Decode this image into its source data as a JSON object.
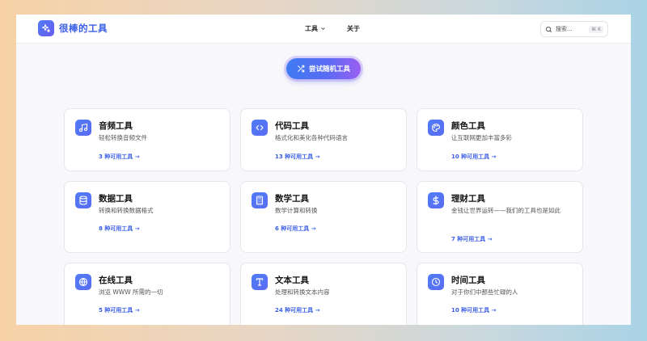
{
  "header": {
    "logo_text": "很棒的工具",
    "nav": [
      {
        "label": "工具",
        "has_dropdown": true
      },
      {
        "label": "关于",
        "has_dropdown": false
      }
    ],
    "search": {
      "placeholder": "搜索...",
      "shortcut": "⌘ K"
    }
  },
  "hero": {
    "random_button_label": "尝试随机工具"
  },
  "categories": [
    {
      "title": "音频工具",
      "desc": "轻松转换音频文件",
      "link": "3 种可用工具 →",
      "icon": "music-note-icon"
    },
    {
      "title": "代码工具",
      "desc": "格式化和美化各种代码语言",
      "link": "13 种可用工具 →",
      "icon": "code-brackets-icon"
    },
    {
      "title": "颜色工具",
      "desc": "让互联网更加丰富多彩",
      "link": "10 种可用工具 →",
      "icon": "palette-icon"
    },
    {
      "title": "数据工具",
      "desc": "转换和转换数据格式",
      "link": "8 种可用工具 →",
      "icon": "database-icon"
    },
    {
      "title": "数学工具",
      "desc": "数学计算和转换",
      "link": "6 种可用工具 →",
      "icon": "calculator-icon"
    },
    {
      "title": "理财工具",
      "desc": "金钱让世界运转——我们的工具也是如此",
      "link": "7 种可用工具 →",
      "icon": "dollar-icon"
    },
    {
      "title": "在线工具",
      "desc": "浏览 WWW 所需的一切",
      "link": "5 种可用工具 →",
      "icon": "globe-icon"
    },
    {
      "title": "文本工具",
      "desc": "处理和转换文本内容",
      "link": "24 种可用工具 →",
      "icon": "text-type-icon"
    },
    {
      "title": "时间工具",
      "desc": "对于你们中那些忙碌的人",
      "link": "10 种可用工具 →",
      "icon": "clock-icon"
    }
  ],
  "colors": {
    "accent": "#3a5ee8",
    "gradient_start": "#3f7bf2",
    "gradient_end": "#9a5ef2"
  }
}
